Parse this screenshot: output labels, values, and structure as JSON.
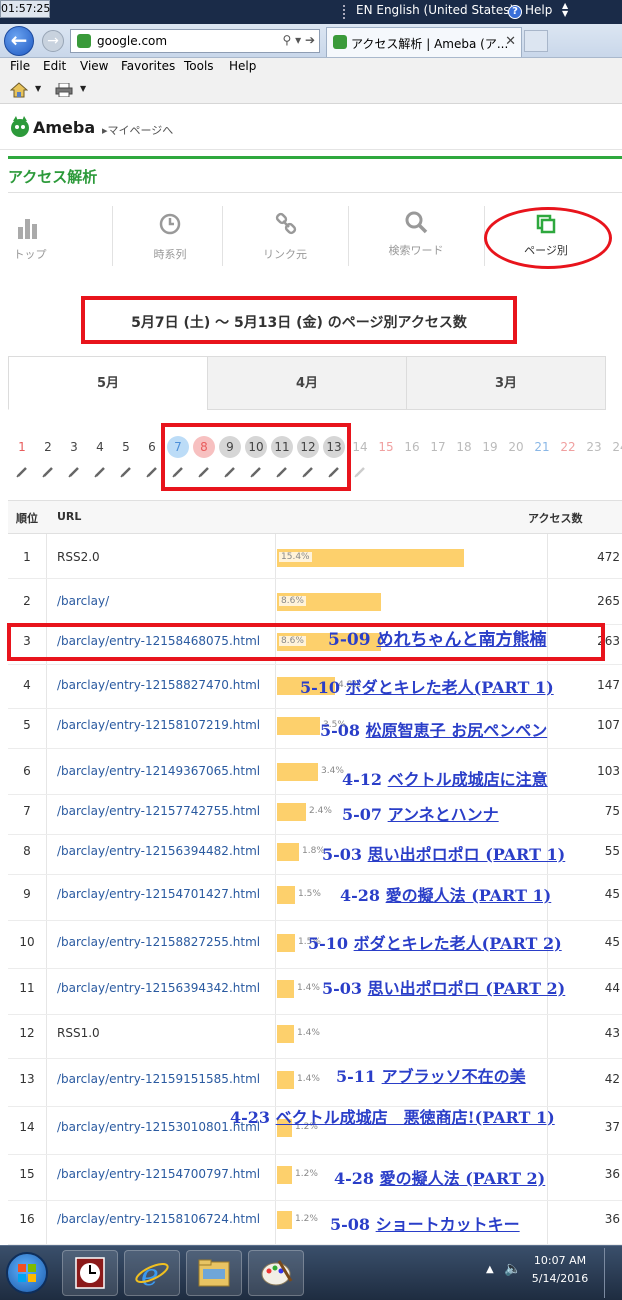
{
  "window": {
    "clock": "01:57:25",
    "language": "EN English (United States)",
    "help": "Help"
  },
  "browser": {
    "url": "google.com",
    "tab_title": "アクセス解析 | Ameba (ア...",
    "menu": [
      "File",
      "Edit",
      "View",
      "Favorites",
      "Tools",
      "Help"
    ]
  },
  "ameba": {
    "logo": "Ameba",
    "mypage_link": "▸マイページへ"
  },
  "analytics": {
    "title": "アクセス解析",
    "nav": [
      {
        "label": "トップ",
        "icon": "bar-chart-icon"
      },
      {
        "label": "時系列",
        "icon": "clock-icon"
      },
      {
        "label": "リンク元",
        "icon": "link-icon"
      },
      {
        "label": "検索ワード",
        "icon": "search-icon"
      },
      {
        "label": "ページ別",
        "icon": "pages-icon",
        "active": true
      }
    ],
    "range_title": "5月7日 (土) ～ 5月13日 (金) のページ別アクセス数",
    "months": [
      "5月",
      "4月",
      "3月"
    ],
    "days": [
      {
        "n": "1",
        "style": "red"
      },
      {
        "n": "2",
        "style": "normal"
      },
      {
        "n": "3",
        "style": "normal"
      },
      {
        "n": "4",
        "style": "normal"
      },
      {
        "n": "5",
        "style": "normal"
      },
      {
        "n": "6",
        "style": "normal"
      },
      {
        "n": "7",
        "style": "sel-blue"
      },
      {
        "n": "8",
        "style": "sel-red"
      },
      {
        "n": "9",
        "style": "sel"
      },
      {
        "n": "10",
        "style": "sel"
      },
      {
        "n": "11",
        "style": "sel"
      },
      {
        "n": "12",
        "style": "sel"
      },
      {
        "n": "13",
        "style": "sel"
      },
      {
        "n": "14",
        "style": "gray"
      },
      {
        "n": "15",
        "style": "gray-red"
      },
      {
        "n": "16",
        "style": "gray"
      },
      {
        "n": "17",
        "style": "gray"
      },
      {
        "n": "18",
        "style": "gray"
      },
      {
        "n": "19",
        "style": "gray"
      },
      {
        "n": "20",
        "style": "gray"
      },
      {
        "n": "21",
        "style": "gray-blue"
      },
      {
        "n": "22",
        "style": "gray-red"
      },
      {
        "n": "23",
        "style": "gray"
      },
      {
        "n": "24",
        "style": "gray"
      }
    ],
    "table_headers": {
      "rank": "順位",
      "url": "URL",
      "count": "アクセス数"
    },
    "rows": [
      {
        "rank": "1",
        "url": "RSS2.0",
        "pct": "15.4%",
        "share": 15.4,
        "count": "472",
        "link": false,
        "note_num": "",
        "note_title": ""
      },
      {
        "rank": "2",
        "url": "/barclay/",
        "pct": "8.6%",
        "share": 8.6,
        "count": "265",
        "link": true,
        "note_num": "",
        "note_title": ""
      },
      {
        "rank": "3",
        "url": "/barclay/entry-12158468075.html",
        "pct": "8.6%",
        "share": 8.6,
        "count": "263",
        "link": true,
        "note_num": "5-09",
        "note_title": "めれちゃんと南方熊楠"
      },
      {
        "rank": "4",
        "url": "/barclay/entry-12158827470.html",
        "pct": "4.8%",
        "share": 4.8,
        "count": "147",
        "link": true,
        "note_num": "5-10",
        "note_title": "ボダとキレた老人(PART 1)"
      },
      {
        "rank": "5",
        "url": "/barclay/entry-12158107219.html",
        "pct": "3.5%",
        "share": 3.5,
        "count": "107",
        "link": true,
        "note_num": "5-08",
        "note_title": "松原智恵子 お尻ペンペン"
      },
      {
        "rank": "6",
        "url": "/barclay/entry-12149367065.html",
        "pct": "3.4%",
        "share": 3.4,
        "count": "103",
        "link": true,
        "note_num": "4-12",
        "note_title": "ベクトル成城店に注意"
      },
      {
        "rank": "7",
        "url": "/barclay/entry-12157742755.html",
        "pct": "2.4%",
        "share": 2.4,
        "count": "75",
        "link": true,
        "note_num": "5-07",
        "note_title": "アンネとハンナ"
      },
      {
        "rank": "8",
        "url": "/barclay/entry-12156394482.html",
        "pct": "1.8%",
        "share": 1.8,
        "count": "55",
        "link": true,
        "note_num": "5-03",
        "note_title": "思い出ポロポロ (PART 1)"
      },
      {
        "rank": "9",
        "url": "/barclay/entry-12154701427.html",
        "pct": "1.5%",
        "share": 1.5,
        "count": "45",
        "link": true,
        "note_num": "4-28",
        "note_title": "愛の擬人法 (PART 1)"
      },
      {
        "rank": "10",
        "url": "/barclay/entry-12158827255.html",
        "pct": "1.5%",
        "share": 1.5,
        "count": "45",
        "link": true,
        "note_num": "5-10",
        "note_title": "ボダとキレた老人(PART 2)"
      },
      {
        "rank": "11",
        "url": "/barclay/entry-12156394342.html",
        "pct": "1.4%",
        "share": 1.4,
        "count": "44",
        "link": true,
        "note_num": "5-03",
        "note_title": "思い出ポロポロ (PART 2)"
      },
      {
        "rank": "12",
        "url": "RSS1.0",
        "pct": "1.4%",
        "share": 1.4,
        "count": "43",
        "link": false,
        "note_num": "",
        "note_title": ""
      },
      {
        "rank": "13",
        "url": "/barclay/entry-12159151585.html",
        "pct": "1.4%",
        "share": 1.4,
        "count": "42",
        "link": true,
        "note_num": "5-11",
        "note_title": "アブラッソ不在の美"
      },
      {
        "rank": "14",
        "url": "/barclay/entry-12153010801.html",
        "pct": "1.2%",
        "share": 1.2,
        "count": "37",
        "link": true,
        "note_num": "4-23",
        "note_title": "ベクトル成城店　悪徳商店!(PART 1)"
      },
      {
        "rank": "15",
        "url": "/barclay/entry-12154700797.html",
        "pct": "1.2%",
        "share": 1.2,
        "count": "36",
        "link": true,
        "note_num": "4-28",
        "note_title": "愛の擬人法 (PART 2)"
      },
      {
        "rank": "16",
        "url": "/barclay/entry-12158106724.html",
        "pct": "1.2%",
        "share": 1.2,
        "count": "36",
        "link": true,
        "note_num": "5-08",
        "note_title": "ショートカットキー"
      }
    ]
  },
  "taskbar": {
    "time": "10:07 AM",
    "date": "5/14/2016",
    "apps": [
      "clock-app-icon",
      "internet-explorer-icon",
      "file-explorer-icon",
      "paint-icon"
    ]
  },
  "colors": {
    "ameba_green": "#2c9a3a",
    "bar": "#fdd06c",
    "annotation_red": "#e8141c",
    "annotation_blue": "#2a3ec8",
    "link": "#2a5aa0"
  }
}
